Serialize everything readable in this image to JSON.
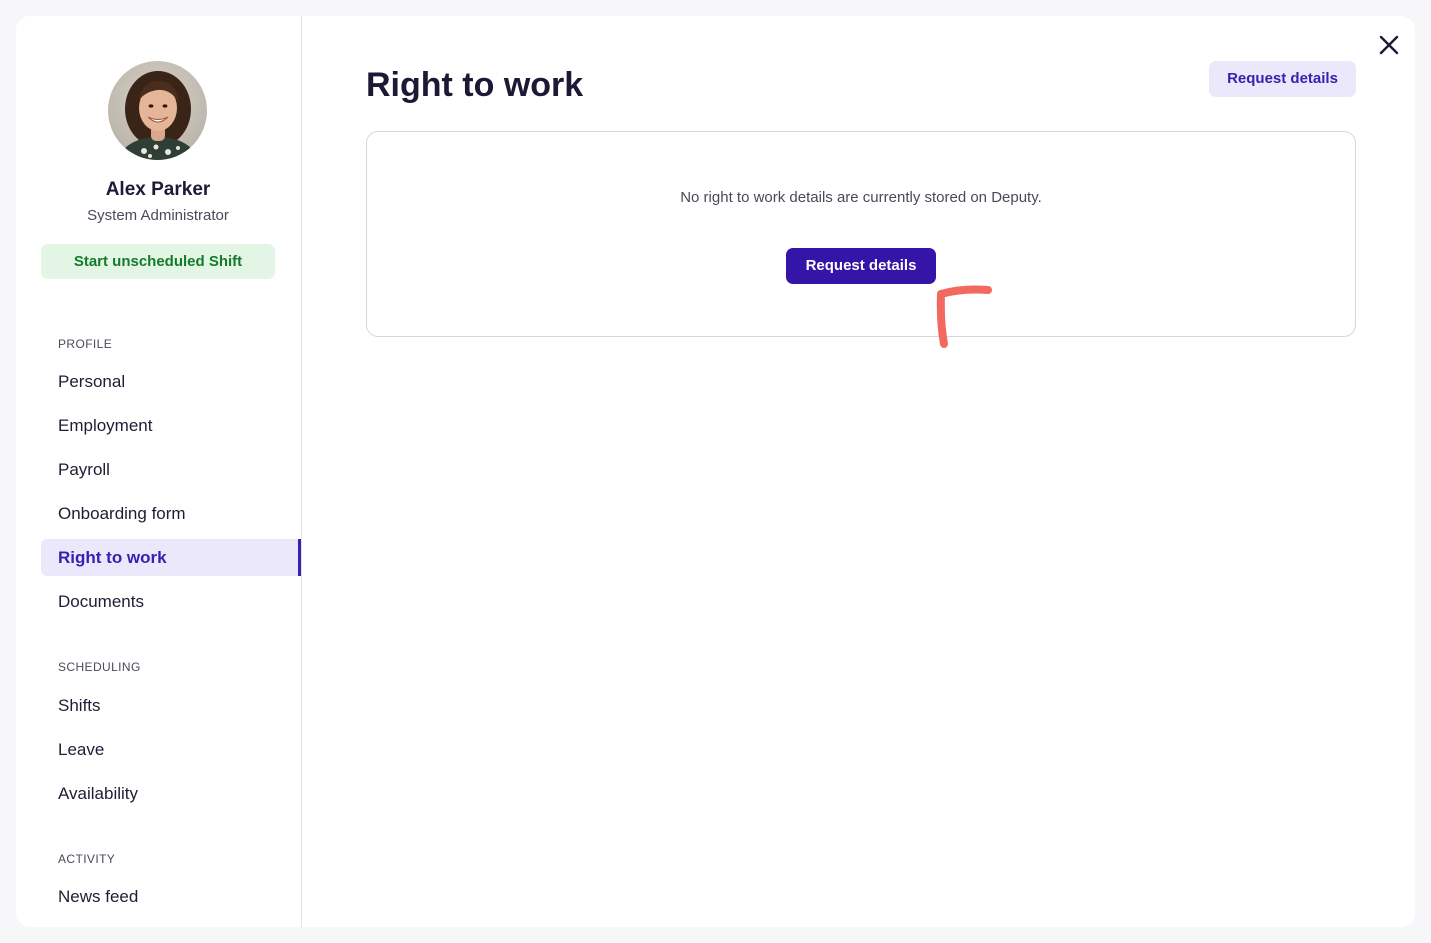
{
  "profile": {
    "name": "Alex Parker",
    "role": "System Administrator",
    "avatar_icon": "user-portrait",
    "start_shift_label": "Start unscheduled Shift"
  },
  "sidebar": {
    "sections": [
      {
        "header": "PROFILE",
        "items": [
          {
            "label": "Personal"
          },
          {
            "label": "Employment"
          },
          {
            "label": "Payroll"
          },
          {
            "label": "Onboarding form"
          },
          {
            "label": "Right to work",
            "active": true
          },
          {
            "label": "Documents"
          }
        ]
      },
      {
        "header": "SCHEDULING",
        "items": [
          {
            "label": "Shifts"
          },
          {
            "label": "Leave"
          },
          {
            "label": "Availability"
          }
        ]
      },
      {
        "header": "ACTIVITY",
        "items": [
          {
            "label": "News feed"
          }
        ]
      }
    ]
  },
  "main": {
    "title": "Right to work",
    "header_button_label": "Request details",
    "close_icon": "close-icon",
    "empty_state": {
      "message": "No right to work details are currently stored on Deputy.",
      "button_label": "Request details"
    }
  },
  "colors": {
    "accent": "#3514a8",
    "accent_soft": "#ebe8fb",
    "success_bg": "#e3f6e6",
    "success_text": "#157a2a",
    "annotation": "#f26a5f"
  }
}
